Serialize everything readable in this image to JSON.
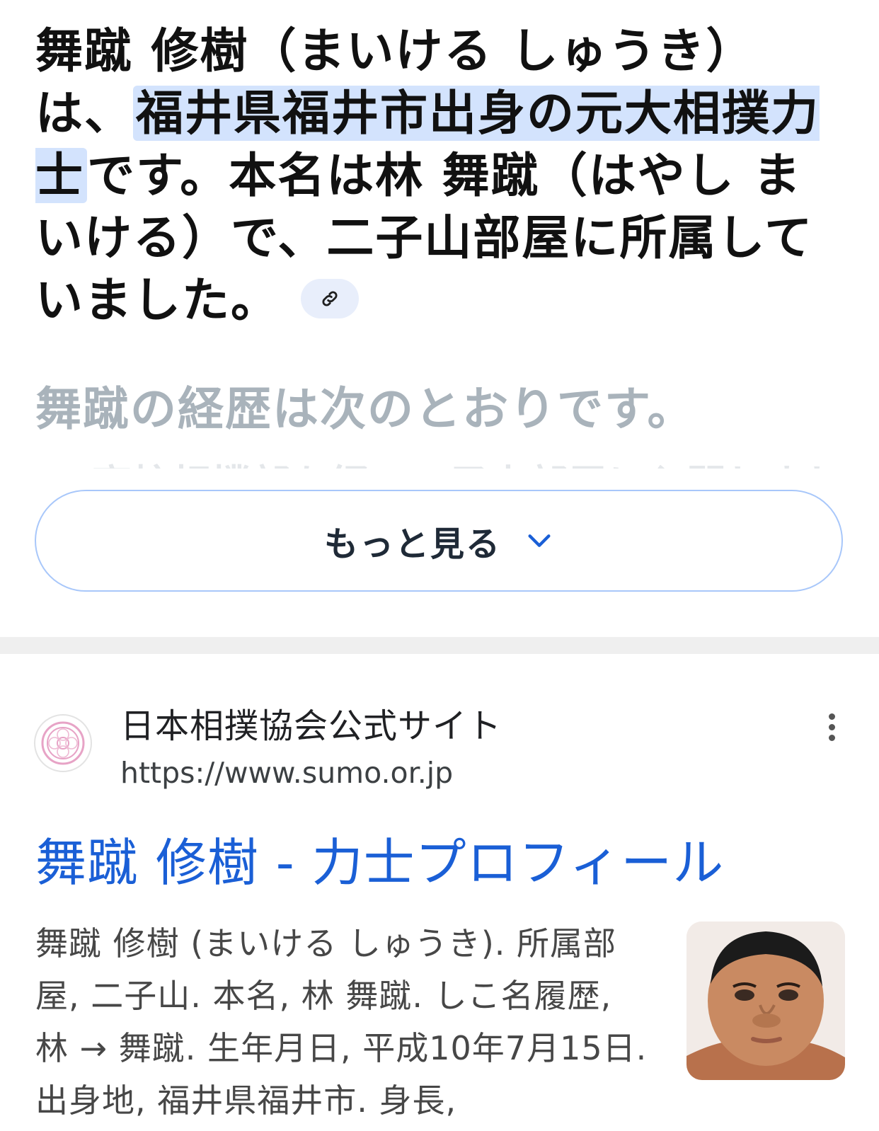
{
  "overview": {
    "text_before": "舞蹴 修樹（まいける しゅうき）は、",
    "highlighted": "福井県福井市出身の元大相撲力士",
    "text_after": "です。本名は林 舞蹴（はやし まいける）で、二子山部屋に所属していました。",
    "citation_icon": "link-icon",
    "faded_line": "舞蹴の経歴は次のとおりです。",
    "faded_line2": "高校相撲部を経て二子山部屋に入門しました"
  },
  "more_button": {
    "label": "もっと見る",
    "icon": "chevron-down-icon"
  },
  "result": {
    "site_name": "日本相撲協会公式サイト",
    "site_url": "https://www.sumo.or.jp",
    "site_icon": "sumo-association-logo",
    "menu_icon": "more-vert-icon",
    "title": "舞蹴 修樹 - 力士プロフィール",
    "snippet": "舞蹴 修樹 (まいける しゅうき). 所属部屋, 二子山. 本名, 林 舞蹴. しこ名履歴, 林 → 舞蹴. 生年月日, 平成10年7月15日. 出身地, 福井県福井市. 身長,",
    "thumbnail": "rikishi-portrait"
  },
  "colors": {
    "highlight": "#d3e3fd",
    "link": "#1a5fd6",
    "button_border": "#a8c7fa"
  }
}
